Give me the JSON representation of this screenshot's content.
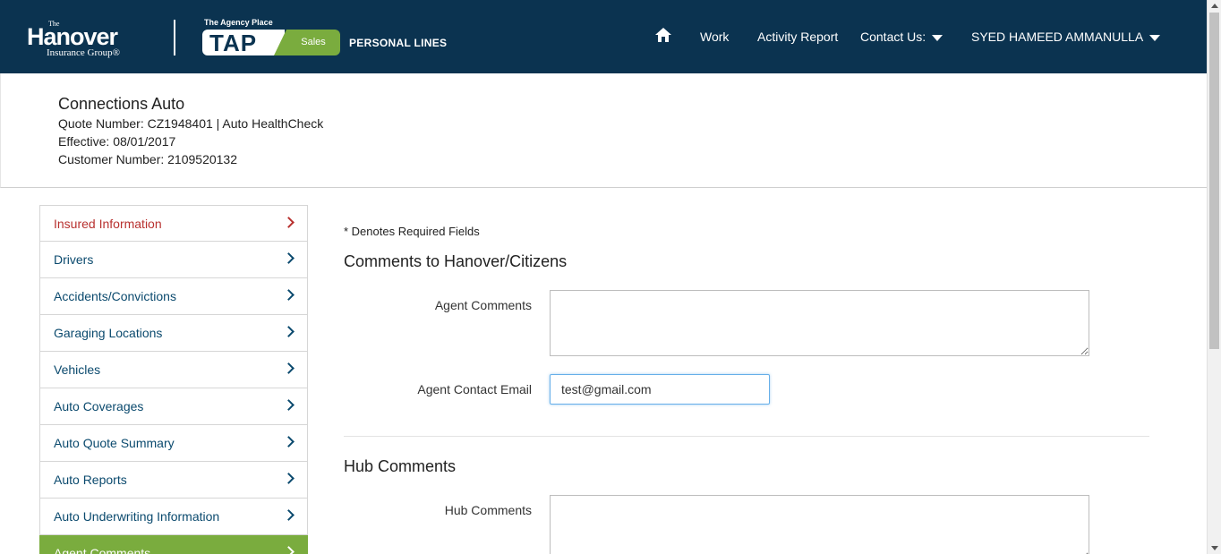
{
  "brand": {
    "the": "The",
    "name": "Hanover",
    "sub": "Insurance Group®",
    "tap_small": "The Agency Place",
    "tap": "TAP",
    "sales": "Sales",
    "personal_lines": "PERSONAL LINES"
  },
  "nav": {
    "home_icon": "home-icon",
    "work": "Work",
    "activity_report": "Activity Report",
    "contact_us": "Contact Us:",
    "user": "SYED HAMEED AMMANULLA"
  },
  "header": {
    "title": "Connections Auto",
    "quote_line": "Quote Number: CZ1948401 | Auto HealthCheck",
    "effective_line": "Effective: 08/01/2017",
    "customer_line": "Customer Number: 2109520132"
  },
  "sidebar": {
    "items": [
      {
        "label": "Insured Information"
      },
      {
        "label": "Drivers"
      },
      {
        "label": "Accidents/Convictions"
      },
      {
        "label": "Garaging Locations"
      },
      {
        "label": "Vehicles"
      },
      {
        "label": "Auto Coverages"
      },
      {
        "label": "Auto Quote Summary"
      },
      {
        "label": "Auto Reports"
      },
      {
        "label": "Auto Underwriting Information"
      },
      {
        "label": "Agent Comments"
      }
    ]
  },
  "main": {
    "required_note": "* Denotes Required Fields",
    "section1_title": "Comments to Hanover/Citizens",
    "agent_comments_label": "Agent Comments",
    "agent_comments_value": "",
    "agent_email_label": "Agent Contact Email",
    "agent_email_value": "test@gmail.com",
    "section2_title": "Hub Comments",
    "hub_comments_label": "Hub Comments",
    "hub_comments_value": ""
  },
  "colors": {
    "navy": "#0b3350",
    "green": "#7aac3e",
    "link": "#0b4a6e",
    "active_red": "#b8312f"
  }
}
